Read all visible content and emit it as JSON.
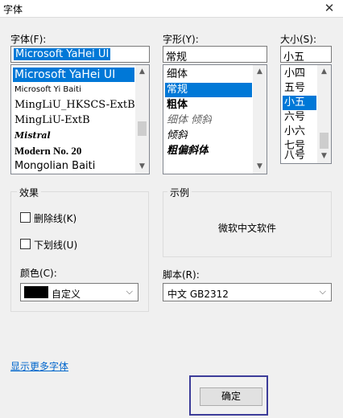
{
  "window": {
    "title": "字体",
    "close_glyph": "✕"
  },
  "font": {
    "label": "字体(F):",
    "value": "Microsoft YaHei UI",
    "items": [
      {
        "label": "Microsoft YaHei UI",
        "selected": true
      },
      {
        "label": "Microsoft Yi Baiti",
        "selected": false
      },
      {
        "label": "MingLiU_HKSCS-ExtB",
        "selected": false
      },
      {
        "label": "MingLiU-ExtB",
        "selected": false
      },
      {
        "label": "Mistral",
        "selected": false
      },
      {
        "label": "Modern No. 20",
        "selected": false
      },
      {
        "label": "Mongolian Baiti",
        "selected": false
      }
    ]
  },
  "style": {
    "label": "字形(Y):",
    "value": "常规",
    "items": [
      {
        "label": "细体",
        "selected": false
      },
      {
        "label": "常规",
        "selected": true
      },
      {
        "label": "粗体",
        "selected": false
      },
      {
        "label": "细体 倾斜",
        "selected": false
      },
      {
        "label": "倾斜",
        "selected": false
      },
      {
        "label": "粗偏斜体",
        "selected": false
      }
    ]
  },
  "size": {
    "label": "大小(S):",
    "value": "小五",
    "items": [
      {
        "label": "小四",
        "selected": false
      },
      {
        "label": "五号",
        "selected": false
      },
      {
        "label": "小五",
        "selected": true
      },
      {
        "label": "六号",
        "selected": false
      },
      {
        "label": "小六",
        "selected": false
      },
      {
        "label": "七号",
        "selected": false
      },
      {
        "label": "八号",
        "selected": false
      }
    ]
  },
  "effects": {
    "label": "效果",
    "strikeout": "删除线(K)",
    "underline": "下划线(U)",
    "color_label": "颜色(C):",
    "color_value": "自定义",
    "color_swatch": "#000000"
  },
  "sample": {
    "label": "示例",
    "text": "微软中文软件"
  },
  "script": {
    "label": "脚本(R):",
    "value": "中文 GB2312"
  },
  "more_fonts_link": "显示更多字体",
  "ok_button": "确定",
  "colors": {
    "selection": "#0078d7",
    "link": "#0066cc",
    "focus": "#3c3c99"
  }
}
